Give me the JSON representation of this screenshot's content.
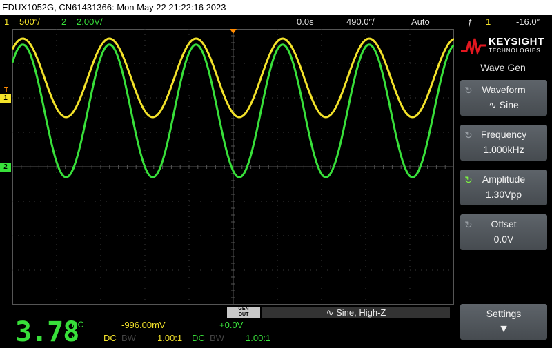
{
  "title": "EDUX1052G, CN61431366: Mon May 22 21:22:16 2023",
  "status": {
    "ch1_num": "1",
    "ch1_scale": "500″/",
    "ch2_num": "2",
    "ch2_scale": "2.00V/",
    "delay": "0.0s",
    "timebase": "490.0″/",
    "trigger_mode": "Auto",
    "trigger_icon": "ƒ",
    "trigger_src": "1",
    "trigger_level": "-16.0″"
  },
  "markers": {
    "ch1": "1",
    "ch2": "2",
    "trig": "T"
  },
  "side": {
    "brand": "KEYSIGHT",
    "brand_sub": "TECHNOLOGIES",
    "menu_title": "Wave Gen",
    "keys": [
      {
        "label": "Waveform",
        "value": "∿ Sine"
      },
      {
        "label": "Frequency",
        "value": "1.000kHz"
      },
      {
        "label": "Amplitude",
        "value": "1.30Vpp"
      },
      {
        "label": "Offset",
        "value": "0.0V"
      },
      {
        "label": "Settings",
        "value": "▼"
      }
    ]
  },
  "bottom": {
    "gen_out_1": "GEN",
    "gen_out_2": "OUT",
    "wavegen_status": "∿  Sine, High-Z",
    "big_value": "3.78",
    "big_unit_top": "DC",
    "big_unit_bottom": "V",
    "ch1_offset": "-996.00mV",
    "ch2_offset": "+0.0V",
    "ch1_coupling": "DC",
    "ch1_bw": "BW",
    "ch1_probe": "1.00:1",
    "ch2_coupling": "DC",
    "ch2_bw": "BW",
    "ch2_probe": "1.00:1"
  },
  "colors": {
    "ch1": "#f3e22a",
    "ch2": "#38e03a",
    "trigger": "#ff8a00"
  },
  "chart_data": {
    "type": "line",
    "xlabel": "",
    "ylabel": "",
    "x_divisions": 10,
    "y_divisions": 8,
    "grid": true,
    "series": [
      {
        "values": [
          1.4,
          4.0
        ],
        "cycles": 5.1
      },
      {
        "values": [
          1.6,
          7.0
        ],
        "cycles": 5.1
      }
    ]
  }
}
